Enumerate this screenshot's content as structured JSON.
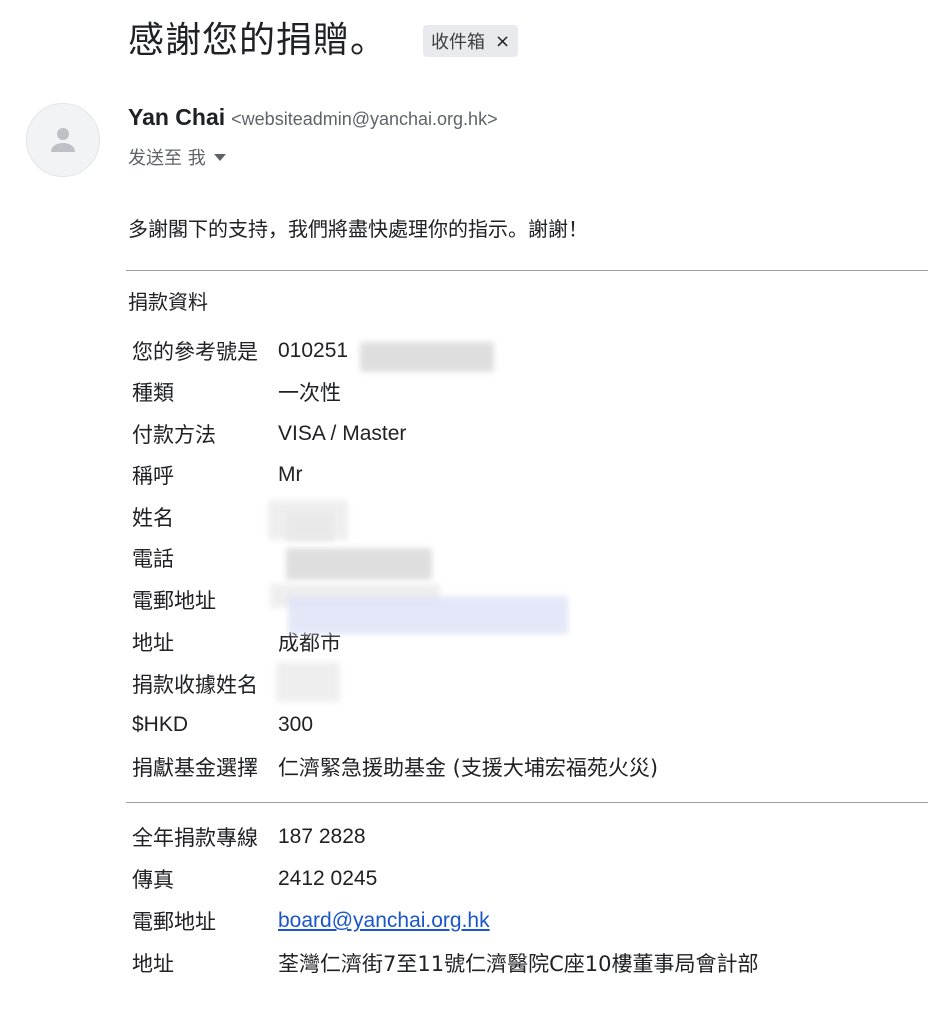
{
  "header": {
    "subject": "感謝您的捐贈。",
    "label": "收件箱",
    "label_remove": "×"
  },
  "sender": {
    "name": "Yan Chai",
    "email": "<websiteadmin@yanchai.org.hk>",
    "recipient_text": "发送至 我"
  },
  "body": {
    "greeting": "多謝閣下的支持，我們將盡快處理你的指示。謝謝！",
    "section_title": "捐款資料",
    "details": [
      {
        "key": "您的參考號是",
        "value": "010251"
      },
      {
        "key": "種類",
        "value": "一次性"
      },
      {
        "key": "付款方法",
        "value": "VISA / Master"
      },
      {
        "key": "稱呼",
        "value": "Mr"
      },
      {
        "key": "姓名",
        "value": ""
      },
      {
        "key": "電話",
        "value": ""
      },
      {
        "key": "電郵地址",
        "value": ""
      },
      {
        "key": "地址",
        "value": "成都市"
      },
      {
        "key": "捐款收據姓名",
        "value": ""
      },
      {
        "key": "$HKD",
        "value": "300"
      },
      {
        "key": "捐獻基金選擇",
        "value": "仁濟緊急援助基金 (支援大埔宏福苑火災)"
      }
    ],
    "contact": [
      {
        "key": "全年捐款專線",
        "value": "187 2828"
      },
      {
        "key": "傳真",
        "value": "2412 0245"
      },
      {
        "key": "電郵地址",
        "value": "board@yanchai.org.hk"
      },
      {
        "key": "地址",
        "value": "荃灣仁濟街7至11號仁濟醫院C座10樓董事局會計部"
      }
    ]
  }
}
